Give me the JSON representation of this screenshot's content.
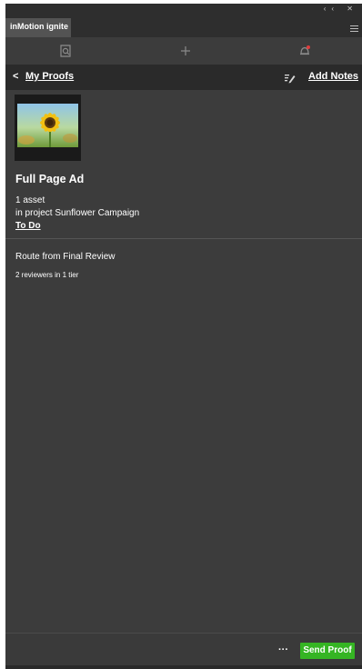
{
  "window": {
    "controls": "‹‹  ✕"
  },
  "tabs": [
    {
      "label": "inMotion ignite"
    }
  ],
  "toolbar": {
    "icons": [
      "search-proof-icon",
      "add-icon",
      "notification-bell-icon"
    ]
  },
  "nav": {
    "back_label": "<",
    "breadcrumb": "My Proofs",
    "add_notes": "Add Notes"
  },
  "proof": {
    "title": "Full Page Ad",
    "asset_count": "1 asset",
    "project": "in project Sunflower Campaign",
    "status": "To Do"
  },
  "route": {
    "label": "Route from Final Review",
    "reviewers": "2 reviewers in 1 tier"
  },
  "footer": {
    "more": "···",
    "send_button": "Send Proof"
  },
  "colors": {
    "accent_green": "#35b523",
    "panel_bg": "#3c3c3c",
    "nav_bg": "#2a2a2a"
  }
}
